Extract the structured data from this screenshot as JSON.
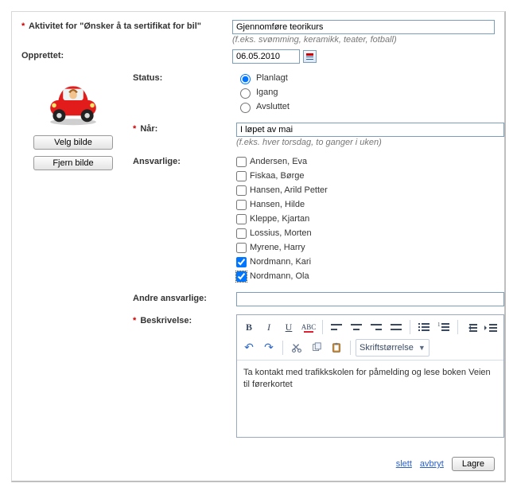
{
  "header": {
    "activity_label_prefix": "Aktivitet for \"Ønsker å ta sertifikat for bil\"",
    "activity_value": "Gjennomføre teorikurs",
    "activity_hint": "(f.eks. svømming, keramikk, teater, fotball)",
    "created_label": "Opprettet:",
    "created_value": "06.05.2010"
  },
  "image": {
    "select_btn": "Velg bilde",
    "remove_btn": "Fjern bilde"
  },
  "status": {
    "label": "Status:",
    "options": [
      {
        "label": "Planlagt",
        "checked": true
      },
      {
        "label": "Igang",
        "checked": false
      },
      {
        "label": "Avsluttet",
        "checked": false
      }
    ]
  },
  "when": {
    "label": "Når:",
    "value": "I løpet av mai",
    "hint": "(f.eks. hver torsdag, to ganger i uken)"
  },
  "responsibles": {
    "label": "Ansvarlige:",
    "items": [
      {
        "label": "Andersen, Eva",
        "checked": false
      },
      {
        "label": "Fiskaa, Børge",
        "checked": false
      },
      {
        "label": "Hansen, Arild Petter",
        "checked": false
      },
      {
        "label": "Hansen, Hilde",
        "checked": false
      },
      {
        "label": "Kleppe, Kjartan",
        "checked": false
      },
      {
        "label": "Lossius, Morten",
        "checked": false
      },
      {
        "label": "Myrene, Harry",
        "checked": false
      },
      {
        "label": "Nordmann, Kari",
        "checked": true
      },
      {
        "label": "Nordmann, Ola",
        "checked": true,
        "focused": true
      }
    ]
  },
  "other_responsibles": {
    "label": "Andre ansvarlige:",
    "value": ""
  },
  "description": {
    "label": "Beskrivelse:",
    "font_size_label": "Skriftstørrelse",
    "body": "Ta kontakt med trafikkskolen for påmelding og lese boken Veien til førerkortet"
  },
  "footer": {
    "delete": "slett",
    "cancel": "avbryt",
    "save": "Lagre"
  }
}
